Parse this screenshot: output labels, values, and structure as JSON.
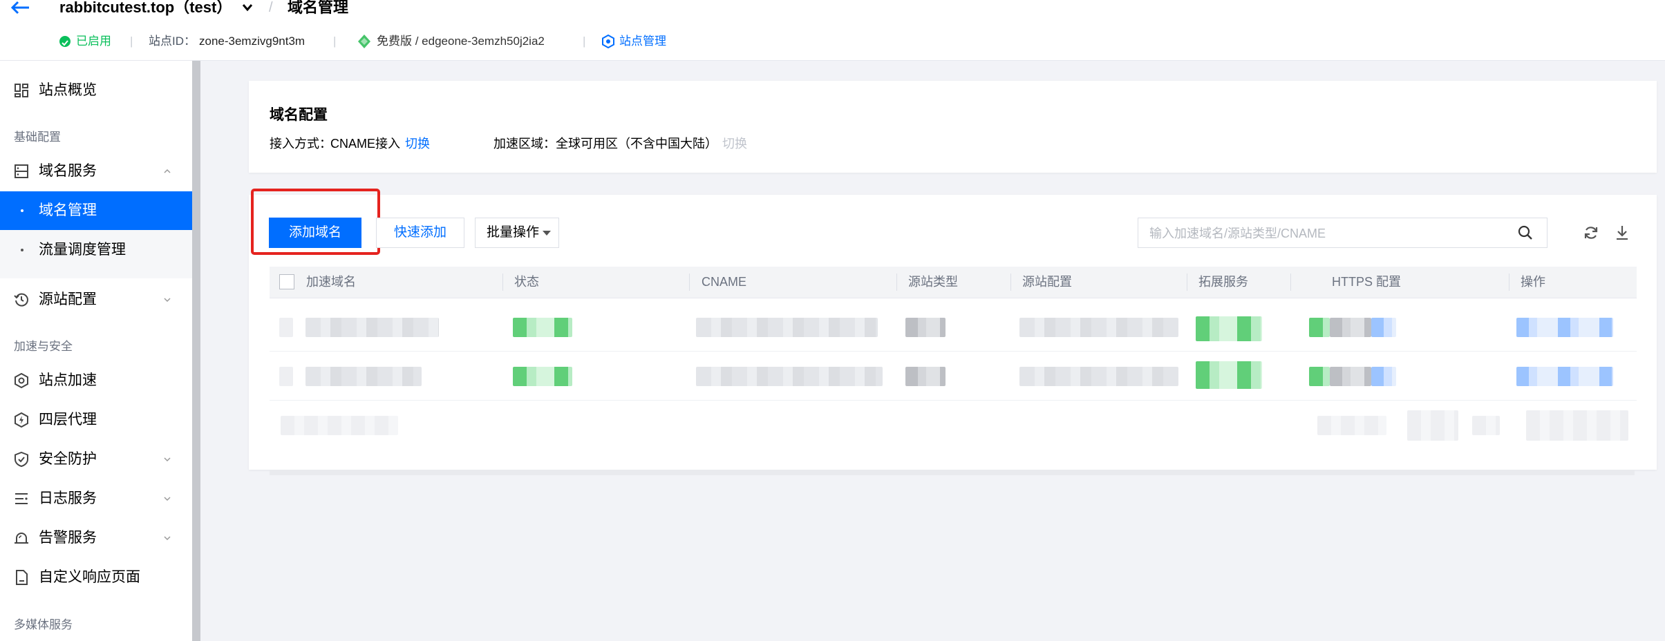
{
  "header": {
    "site_name": "rabbitcutest.top（test）",
    "breadcrumb_sep": "/",
    "page_title": "域名管理",
    "status": "已启用",
    "zone_label": "站点ID：",
    "zone_id": "zone-3emzivg9nt3m",
    "plan": "免费版 / edgeone-3emzh50j2ia2",
    "site_mgmt_link": "站点管理",
    "separator": "|"
  },
  "sidebar": {
    "overview": "站点概览",
    "group_basic": "基础配置",
    "domain_service": "域名服务",
    "sub_domain_mgmt": "域名管理",
    "sub_traffic": "流量调度管理",
    "origin_config": "源站配置",
    "group_accel": "加速与安全",
    "site_accel": "站点加速",
    "l4_proxy": "四层代理",
    "security": "安全防护",
    "log_service": "日志服务",
    "alarm_service": "告警服务",
    "custom_page": "自定义响应页面",
    "group_media": "多媒体服务"
  },
  "config_panel": {
    "title": "域名配置",
    "access_label": "接入方式：",
    "access_value": "CNAME接入",
    "access_switch": "切换",
    "region_label": "加速区域：",
    "region_value": "全球可用区（不含中国大陆）",
    "region_switch": "切换"
  },
  "toolbar": {
    "add_domain": "添加域名",
    "quick_add": "快速添加",
    "batch_ops": "批量操作",
    "search_placeholder": "输入加速域名/源站类型/CNAME"
  },
  "table": {
    "columns": [
      "加速域名",
      "状态",
      "CNAME",
      "源站类型",
      "源站配置",
      "拓展服务",
      "HTTPS 配置",
      "操作"
    ]
  },
  "colors": {
    "primary": "#006eff",
    "success": "#0abf5b",
    "highlight": "#e5231f"
  }
}
